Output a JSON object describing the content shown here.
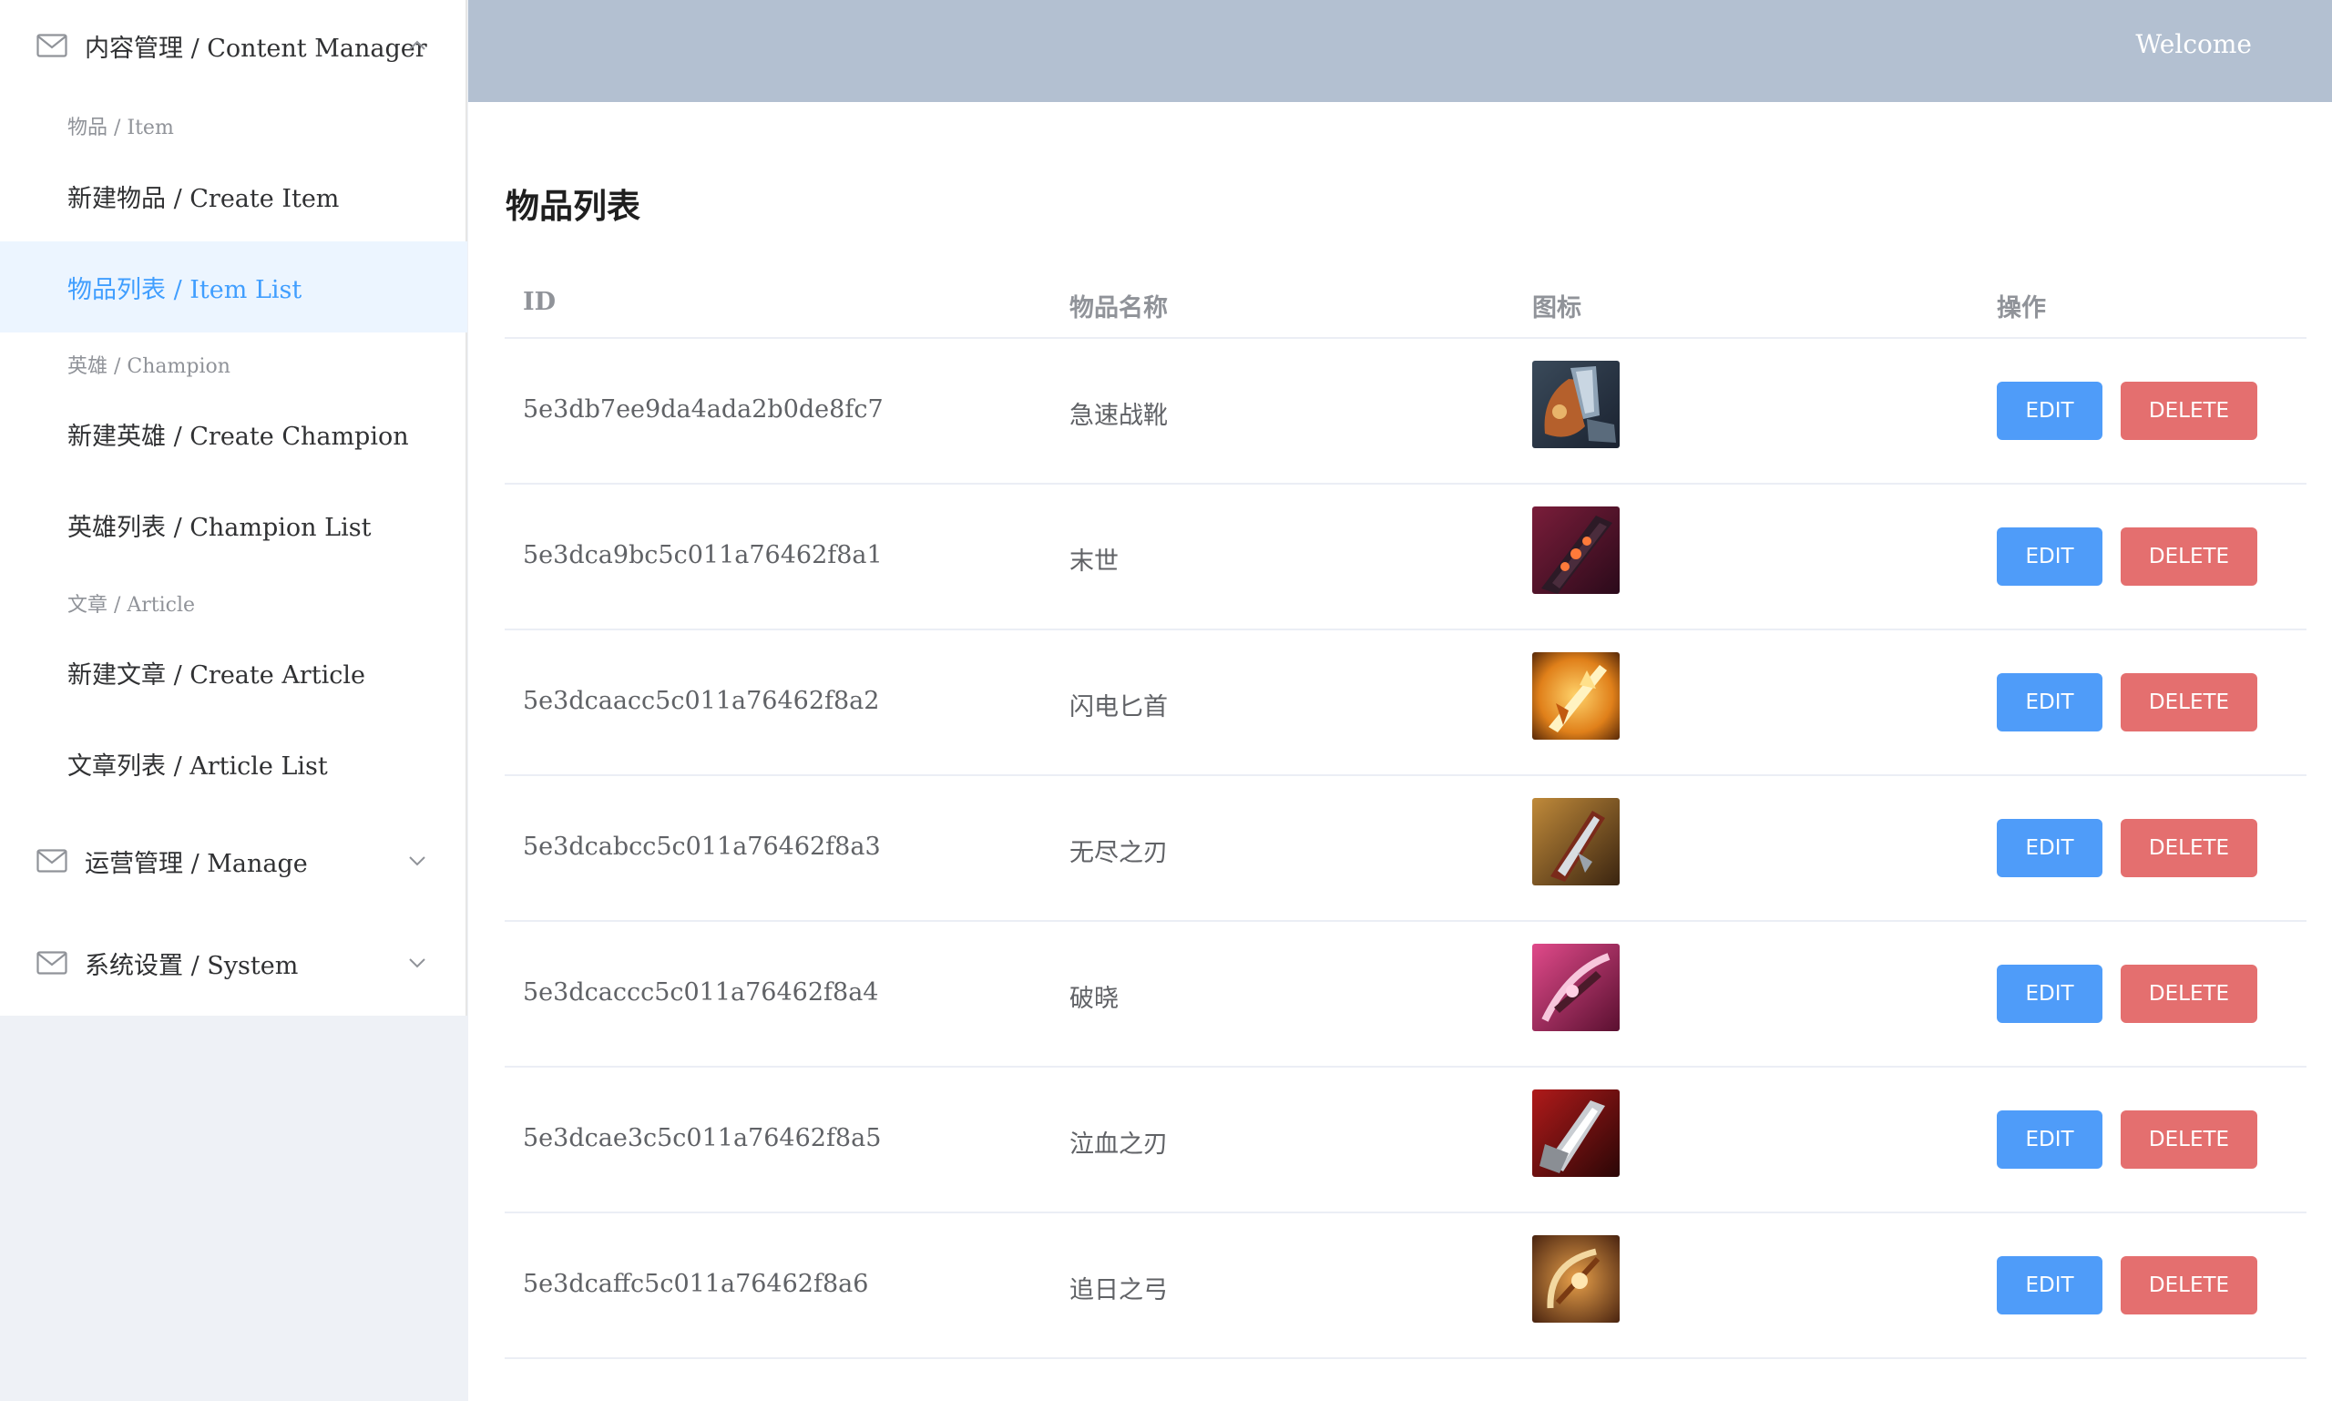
{
  "header": {
    "welcome": "Welcome"
  },
  "sidebar": {
    "content_manager": {
      "label": "内容管理 / Content Manager"
    },
    "item_group": "物品 / Item",
    "create_item": "新建物品 / Create Item",
    "item_list": "物品列表 / Item List",
    "champion_group": "英雄 / Champion",
    "create_champion": "新建英雄 / Create Champion",
    "champion_list": "英雄列表 / Champion List",
    "article_group": "文章 / Article",
    "create_article": "新建文章 / Create Article",
    "article_list": "文章列表 / Article List",
    "manage": {
      "label": "运营管理 / Manage"
    },
    "system": {
      "label": "系统设置 / System"
    }
  },
  "main": {
    "title": "物品列表",
    "columns": {
      "id": "ID",
      "name": "物品名称",
      "icon": "图标",
      "actions": "操作"
    },
    "edit_label": "EDIT",
    "delete_label": "DELETE",
    "rows": [
      {
        "id": "5e3db7ee9da4ada2b0de8fc7",
        "name": "急速战靴",
        "icon": "boots-item-icon"
      },
      {
        "id": "5e3dca9bc5c011a76462f8a1",
        "name": "末世",
        "icon": "doom-blade-item-icon"
      },
      {
        "id": "5e3dcaacc5c011a76462f8a2",
        "name": "闪电匕首",
        "icon": "lightning-dagger-item-icon"
      },
      {
        "id": "5e3dcabcc5c011a76462f8a3",
        "name": "无尽之刃",
        "icon": "infinity-blade-item-icon"
      },
      {
        "id": "5e3dcaccc5c011a76462f8a4",
        "name": "破晓",
        "icon": "dawn-bow-item-icon"
      },
      {
        "id": "5e3dcae3c5c011a76462f8a5",
        "name": "泣血之刃",
        "icon": "bloodweeping-blade-item-icon"
      },
      {
        "id": "5e3dcaffc5c011a76462f8a6",
        "name": "追日之弓",
        "icon": "sun-chaser-bow-item-icon"
      }
    ]
  },
  "colors": {
    "header_bg": "#b3c0d1",
    "active_menu_text": "#409eff",
    "active_menu_bg": "#ecf5ff",
    "edit_button": "#4f9cf9",
    "delete_button": "#e46f6f"
  }
}
